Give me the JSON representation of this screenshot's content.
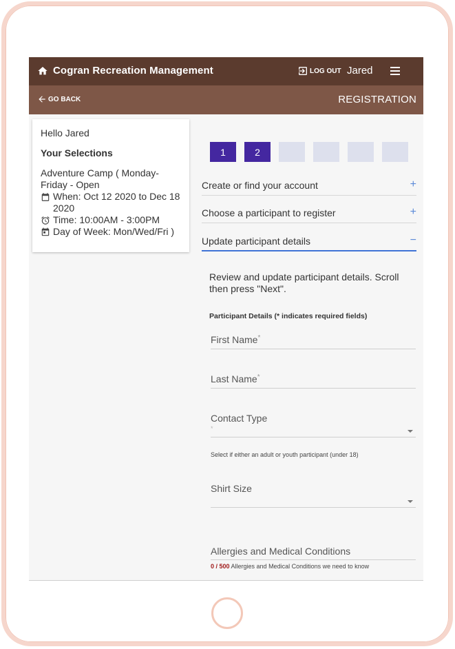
{
  "app": {
    "title": "Cogran Recreation Management",
    "logout_label": "LOG OUT",
    "user_name": "Jared"
  },
  "subbar": {
    "back_label": "GO BACK",
    "breadcrumb": "REGISTRATION"
  },
  "selections": {
    "greeting": "Hello Jared",
    "heading": "Your Selections",
    "program": "Adventure Camp ( Monday-Friday - Open",
    "when": "When: Oct 12 2020 to Dec 18 2020",
    "time": "Time: 10:00AM - 3:00PM",
    "days": "Day of Week: Mon/Wed/Fri )"
  },
  "steps": [
    {
      "label": "1",
      "state": "done"
    },
    {
      "label": "2",
      "state": "done"
    },
    {
      "label": "",
      "state": "pending"
    },
    {
      "label": "",
      "state": "pending"
    },
    {
      "label": "",
      "state": "pending"
    },
    {
      "label": "",
      "state": "pending"
    }
  ],
  "accordion": [
    {
      "label": "Create or find your account",
      "sign": "+"
    },
    {
      "label": "Choose a participant to register",
      "sign": "+"
    },
    {
      "label": "Update participant details",
      "sign": "−"
    }
  ],
  "details": {
    "description": "Review and update participant details. Scroll then press \"Next\".",
    "section_title": "Participant Details (* indicates required fields)",
    "first_name": {
      "label": "First Name",
      "required": "*",
      "value": ""
    },
    "last_name": {
      "label": "Last Name",
      "required": "*",
      "value": ""
    },
    "contact_type": {
      "label": "Contact Type",
      "required": "*",
      "value": "",
      "hint": "Select if either an adult or youth participant (under 18)"
    },
    "shirt_size": {
      "label": "Shirt Size",
      "value": ""
    },
    "allergies": {
      "label": "Allergies and Medical Conditions",
      "counter": "0 / 500",
      "hint": "Allergies and Medical Conditions we need to know"
    }
  },
  "colors": {
    "topbar": "#5b3b2e",
    "subbar": "#7e5747",
    "step_active": "#4427a0",
    "step_pending": "#dde0ed",
    "accent": "#3f73d6",
    "device_frame": "#f6d6cc"
  }
}
